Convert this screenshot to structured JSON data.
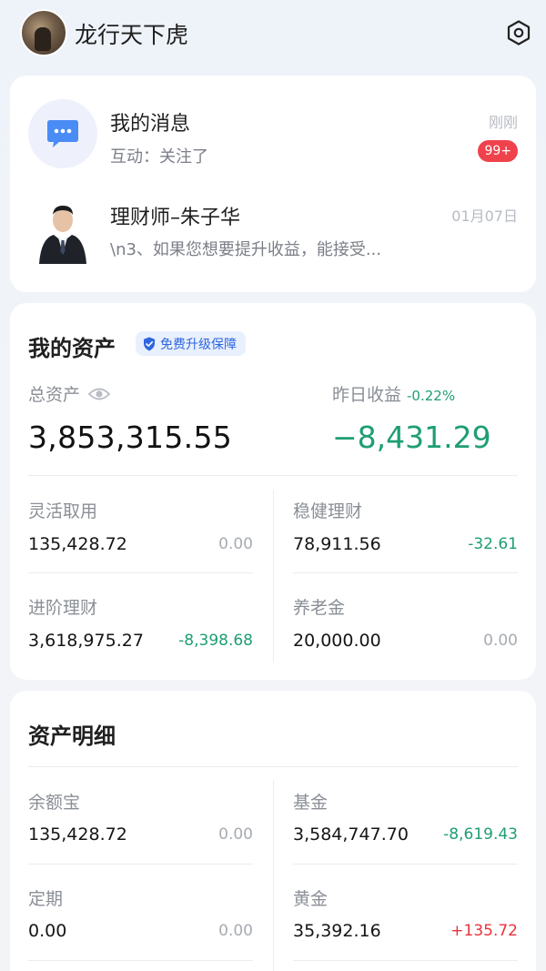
{
  "header": {
    "user_name": "龙行天下虎"
  },
  "messages": {
    "system": {
      "title": "我的消息",
      "subtitle": "互动：关注了",
      "time": "刚刚",
      "badge": "99+"
    },
    "advisor": {
      "title": "理财师–朱子华",
      "subtitle": "\\n3、如果您想要提升收益，能接受...",
      "time": "01月07日"
    }
  },
  "assets": {
    "title": "我的资产",
    "upgrade_tag": "免费升级保障",
    "total_label": "总资产",
    "total_value": "3,853,315.55",
    "yesterday_label": "昨日收益",
    "yesterday_pct": "-0.22%",
    "yesterday_value": "−8,431.29",
    "items": [
      {
        "label": "灵活取用",
        "value": "135,428.72",
        "delta": "0.00",
        "trend": "neutral"
      },
      {
        "label": "稳健理财",
        "value": "78,911.56",
        "delta": "-32.61",
        "trend": "down"
      },
      {
        "label": "进阶理财",
        "value": "3,618,975.27",
        "delta": "-8,398.68",
        "trend": "down"
      },
      {
        "label": "养老金",
        "value": "20,000.00",
        "delta": "0.00",
        "trend": "neutral"
      }
    ]
  },
  "details": {
    "title": "资产明细",
    "items": [
      {
        "label": "余额宝",
        "value": "135,428.72",
        "delta": "0.00",
        "trend": "neutral"
      },
      {
        "label": "基金",
        "value": "3,584,747.70",
        "delta": "-8,619.43",
        "trend": "down"
      },
      {
        "label": "定期",
        "value": "0.00",
        "delta": "0.00",
        "trend": "neutral"
      },
      {
        "label": "黄金",
        "value": "35,392.16",
        "delta": "+135.72",
        "trend": "up"
      }
    ]
  },
  "colors": {
    "accent_blue": "#2f66e0",
    "loss_green": "#1e9e74",
    "gain_red": "#e8323d",
    "badge_red": "#f0424c"
  },
  "icons": {
    "settings": "hexagon-gear-icon",
    "messages": "chat-bubble-icon",
    "eye": "eye-icon",
    "shield": "shield-check-icon"
  }
}
